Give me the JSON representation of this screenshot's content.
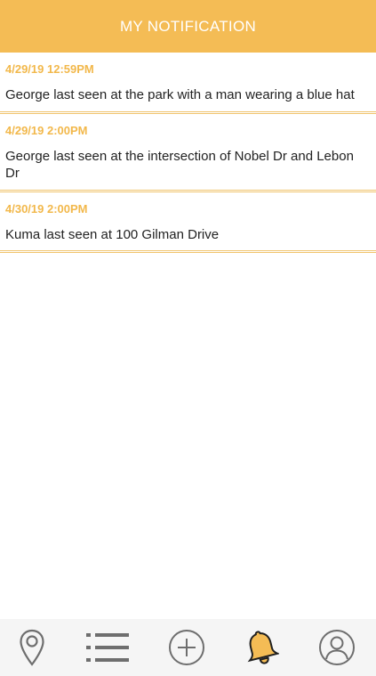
{
  "header": {
    "title": "MY NOTIFICATION"
  },
  "notifications": [
    {
      "time": "4/29/19 12:59PM",
      "text": "George last seen at the park with a man wearing a blue hat"
    },
    {
      "time": "4/29/19 2:00PM",
      "text": "George last seen at the intersection of Nobel Dr and Lebon Dr"
    },
    {
      "time": "4/30/19 2:00PM",
      "text": "Kuma last seen at 100 Gilman Drive"
    }
  ],
  "tabbar": {
    "items": [
      {
        "icon": "map-pin-icon"
      },
      {
        "icon": "list-icon"
      },
      {
        "icon": "add-icon"
      },
      {
        "icon": "bell-icon",
        "active": true
      },
      {
        "icon": "profile-icon"
      }
    ],
    "active_color": "#f4bc55",
    "inactive_color": "#6e6e6e"
  },
  "colors": {
    "accent": "#f4bc55",
    "timestamp": "#f2b84b",
    "text": "#222222"
  }
}
